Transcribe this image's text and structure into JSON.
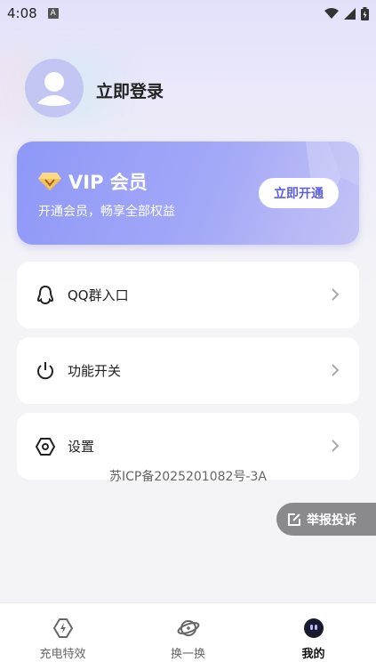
{
  "status_bar": {
    "time": "4:08",
    "notification_badge": "A"
  },
  "profile": {
    "login_label": "立即登录",
    "avatar_color": "#c3c6f3"
  },
  "vip": {
    "title": "VIP 会员",
    "subtitle": "开通会员，畅享全部权益",
    "button_label": "立即开通",
    "accent": "#5b5fe0"
  },
  "menu": [
    {
      "label": "QQ群入口",
      "icon": "qq-penguin-icon"
    },
    {
      "label": "功能开关",
      "icon": "power-icon"
    },
    {
      "label": "设置",
      "icon": "settings-hexagon-icon"
    }
  ],
  "footer": {
    "icp": "苏ICP备2025201082号-3A"
  },
  "report": {
    "label": "举报投诉",
    "icon": "edit-icon"
  },
  "tabs": [
    {
      "label": "充电特效",
      "icon": "charging-bolt-icon",
      "active": false
    },
    {
      "label": "换一换",
      "icon": "planet-icon",
      "active": false
    },
    {
      "label": "我的",
      "icon": "profile-face-icon",
      "active": true
    }
  ]
}
